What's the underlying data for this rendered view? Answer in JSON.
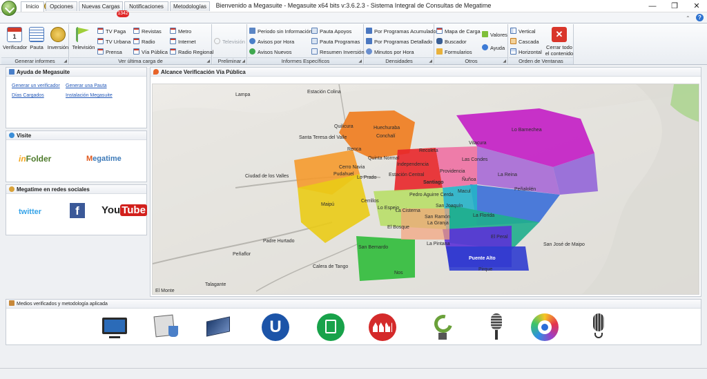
{
  "window": {
    "title": "Bienvenido a Megasuite - Megasuite x64 bits v:3.6.2.3 - Sistema Integral de Consultas de Megatime",
    "minimize": "—",
    "maximize": "❐",
    "close": "✕"
  },
  "tabs": [
    {
      "label": "Inicio",
      "active": true
    },
    {
      "label": "Opciones"
    },
    {
      "label": "Nuevas Cargas",
      "badge": "1342"
    },
    {
      "label": "Notificaciones"
    },
    {
      "label": "Metodologías"
    }
  ],
  "ribbon": {
    "help_glyph": "?",
    "groups": {
      "generar": {
        "label": "Generar informes",
        "buttons": [
          "Verificador",
          "Pauta",
          "Inversión"
        ]
      },
      "ultima": {
        "label": "Ver última carga de",
        "big": "Televisión",
        "col1": [
          "TV Paga",
          "TV Urbana",
          "Prensa"
        ],
        "col2": [
          "Revistas",
          "Radio",
          "Vía Pública"
        ],
        "col3": [
          "Metro",
          "Internet",
          "Radio Regional"
        ]
      },
      "preliminar": {
        "label": "Preliminar",
        "items": [
          "Televisión"
        ]
      },
      "especificos": {
        "label": "Informes Específicos",
        "col1": [
          "Periodo sin Información",
          "Avisos por Hora",
          "Avisos Nuevos"
        ],
        "col2": [
          "Pauta Apoyos",
          "Pauta Programas",
          "Resumen Inversión"
        ]
      },
      "densidades": {
        "label": "Densidades",
        "items": [
          "Por Programas Acumulado",
          "Por Programas Detallado",
          "Minutos por Hora"
        ]
      },
      "otros": {
        "label": "Otros",
        "col1": [
          "Mapa de Carga",
          "Buscador",
          "Formularios"
        ],
        "col2": [
          "Valores",
          "Ayuda"
        ]
      },
      "ventanas": {
        "label": "Orden de Ventanas",
        "items": [
          "Vertical",
          "Cascada",
          "Horizontal"
        ],
        "close_all": [
          "Cerrar todo",
          "el contenido"
        ]
      }
    }
  },
  "left": {
    "ayuda": {
      "title": "Ayuda de Megasuite",
      "links": [
        "Generar un verificador",
        "Generar una Pauta",
        "Días Cargados",
        "Instalación Megasuite"
      ]
    },
    "visite": {
      "title": "Visite",
      "logos": {
        "infolder_a": "in",
        "infolder_b": "Folder",
        "megatime_a": "M",
        "megatime_b": "egatime"
      }
    },
    "redes": {
      "title": "Megatime en redes sociales",
      "twitter": "twitter",
      "facebook": "f",
      "youtube_a": "You",
      "youtube_b": "Tube"
    }
  },
  "map": {
    "title": "Alcance Verificación Vía Pública",
    "labels": [
      "Estación Colina",
      "Lampa",
      "Quilicura",
      "Huechuraba",
      "Santa Teresa del Valle",
      "Lo Barnechea",
      "Vitacura",
      "Renca",
      "Conchalí",
      "Recoleta",
      "Las Condes",
      "Quinta Normal",
      "Independencia",
      "Cerro Navia",
      "Providencia",
      "Pudahuel",
      "Lo Prado",
      "Estación Central",
      "Santiago",
      "Ñuñoa",
      "La Reina",
      "Ciudad de los Valles",
      "Macul",
      "Peñalolén",
      "Padre Hurtado",
      "Maipú",
      "Cerrillos",
      "Pedro Aguirre Cerda",
      "San Joaquín",
      "La Florida",
      "La Cisterna",
      "La Granja",
      "San Ramón",
      "El Bosque",
      "La Pintana",
      "Puente Alto",
      "San Bernardo",
      "Peñaflor",
      "Calera de Tango",
      "Talagante",
      "El Monte",
      "Nos",
      "Pirque",
      "San José de Maipo",
      "El Peral",
      "Lo Espejo",
      "La Cisterna"
    ]
  },
  "medios": {
    "title": "Medios verificados y metodología aplicada",
    "items": [
      "television-icon",
      "newspaper-icon",
      "magazine-icon",
      "metro-icon",
      "billboard-icon",
      "cinema-icon",
      "satellite-dish-icon",
      "radio-microphone-icon",
      "internet-eye-icon",
      "vintage-microphone-icon"
    ]
  }
}
